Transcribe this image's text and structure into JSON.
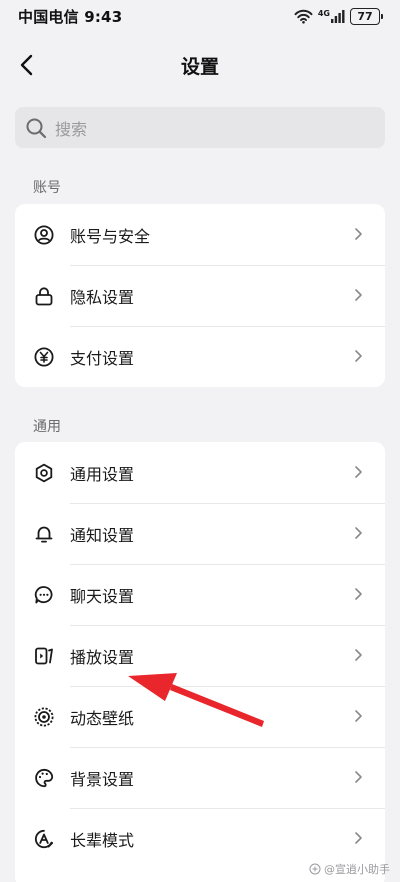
{
  "status_bar": {
    "carrier_time": "中国电信 9:43",
    "network": "4G",
    "battery": "77"
  },
  "header": {
    "title": "设置",
    "back_icon": "chevron-left-icon"
  },
  "search": {
    "placeholder": "搜索",
    "icon": "search-icon"
  },
  "sections": [
    {
      "label": "账号",
      "items": [
        {
          "label": "账号与安全",
          "icon": "user-circle-icon"
        },
        {
          "label": "隐私设置",
          "icon": "lock-icon"
        },
        {
          "label": "支付设置",
          "icon": "yuan-icon"
        }
      ]
    },
    {
      "label": "通用",
      "items": [
        {
          "label": "通用设置",
          "icon": "gear-icon"
        },
        {
          "label": "通知设置",
          "icon": "bell-icon"
        },
        {
          "label": "聊天设置",
          "icon": "chat-bubble-icon"
        },
        {
          "label": "播放设置",
          "icon": "play-device-icon"
        },
        {
          "label": "动态壁纸",
          "icon": "dynamic-wallpaper-icon"
        },
        {
          "label": "背景设置",
          "icon": "palette-icon"
        },
        {
          "label": "长辈模式",
          "icon": "elder-mode-icon"
        }
      ]
    }
  ],
  "watermark": "@宣逍小助手",
  "colors": {
    "background": "#f2f2f4",
    "card": "#ffffff",
    "search_bg": "#e6e6e8",
    "annotation_arrow": "#e8262b"
  }
}
